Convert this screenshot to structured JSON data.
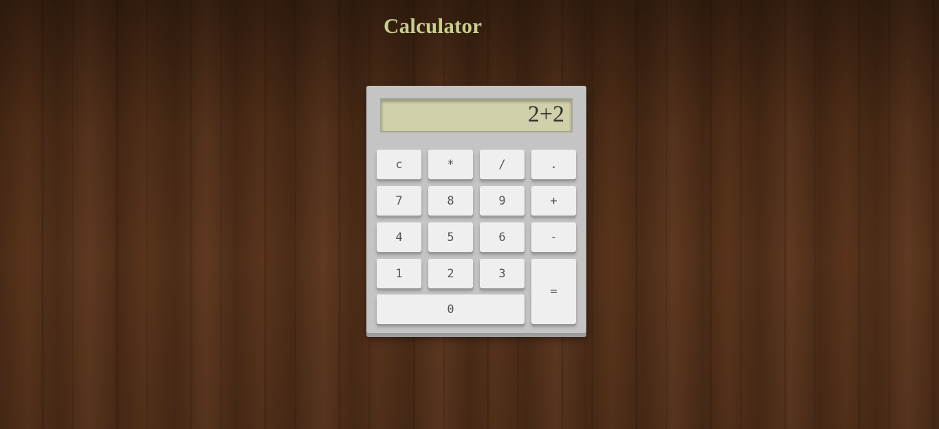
{
  "page": {
    "title": "Calculator"
  },
  "calculator": {
    "display": "2+2",
    "keys": {
      "clear": "c",
      "multiply": "*",
      "divide": "/",
      "decimal": ".",
      "seven": "7",
      "eight": "8",
      "nine": "9",
      "plus": "+",
      "four": "4",
      "five": "5",
      "six": "6",
      "minus": "-",
      "one": "1",
      "two": "2",
      "three": "3",
      "equals": "=",
      "zero": "0"
    }
  },
  "colors": {
    "title": "#c7cf8e",
    "body_bg": "#c4c4c4",
    "display_bg": "#d0d0aa",
    "key_bg": "#efefef"
  }
}
